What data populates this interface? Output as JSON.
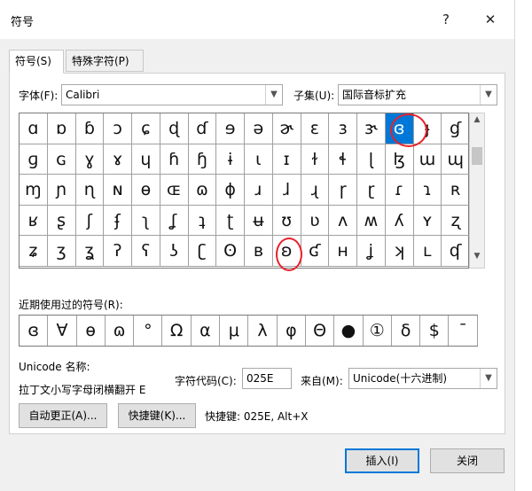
{
  "window": {
    "title": "符号",
    "help_label": "?",
    "close_label": "✕"
  },
  "tabs": [
    {
      "label": "符号(S)",
      "active": true
    },
    {
      "label": "特殊字符(P)",
      "active": false
    }
  ],
  "font": {
    "label": "字体(F):",
    "value": "Calibri"
  },
  "subset": {
    "label": "子集(U):",
    "value": "国际音标扩充"
  },
  "symbols": [
    [
      "ɑ",
      "ɒ",
      "ɓ",
      "ɔ",
      "ɕ",
      "ɖ",
      "ɗ",
      "ɘ",
      "ə",
      "ɚ",
      "ɛ",
      "ɜ",
      "ɝ",
      "ɞ",
      "ɟ",
      "ɠ"
    ],
    [
      "ɡ",
      "ɢ",
      "ɣ",
      "ɤ",
      "ɥ",
      "ɦ",
      "ɧ",
      "ɨ",
      "ɩ",
      "ɪ",
      "ɫ",
      "ɬ",
      "ɭ",
      "ɮ",
      "ɯ",
      "ɰ"
    ],
    [
      "ɱ",
      "ɲ",
      "ɳ",
      "ɴ",
      "ɵ",
      "ɶ",
      "ɷ",
      "ɸ",
      "ɹ",
      "ɺ",
      "ɻ",
      "ɼ",
      "ɽ",
      "ɾ",
      "ɿ",
      "ʀ"
    ],
    [
      "ʁ",
      "ʂ",
      "ʃ",
      "ʄ",
      "ʅ",
      "ʆ",
      "ʇ",
      "ʈ",
      "ʉ",
      "ʊ",
      "ʋ",
      "ʌ",
      "ʍ",
      "ʎ",
      "ʏ",
      "ʐ"
    ],
    [
      "ʑ",
      "ʒ",
      "ʓ",
      "ʔ",
      "ʕ",
      "ʖ",
      "ʗ",
      "ʘ",
      "ʙ",
      "ʚ",
      "ʛ",
      "ʜ",
      "ʝ",
      "ʞ",
      "ʟ",
      "ʠ"
    ]
  ],
  "selected": {
    "row": 0,
    "col": 13
  },
  "recent": {
    "label": "近期使用过的符号(R):",
    "symbols": [
      "ɞ",
      "∀",
      "ɵ",
      "ɷ",
      "°",
      "Ω",
      "α",
      "μ",
      "λ",
      "φ",
      "Θ",
      "●",
      "①",
      "δ",
      "$",
      "ˉ"
    ]
  },
  "unicode_name_label": "Unicode 名称:",
  "unicode_name_value": "拉丁文小写字母闭横翻开 E",
  "char_code": {
    "label": "字符代码(C):",
    "value": "025E"
  },
  "from": {
    "label": "来自(M):",
    "value": "Unicode(十六进制)"
  },
  "buttons": {
    "autocorrect": "自动更正(A)...",
    "shortcut_key": "快捷键(K)...",
    "shortcut_text": "快捷键: 025E, Alt+X",
    "insert": "插入(I)",
    "close": "关闭"
  },
  "annotation_color": "#e8202a",
  "accent_color": "#0078d7"
}
